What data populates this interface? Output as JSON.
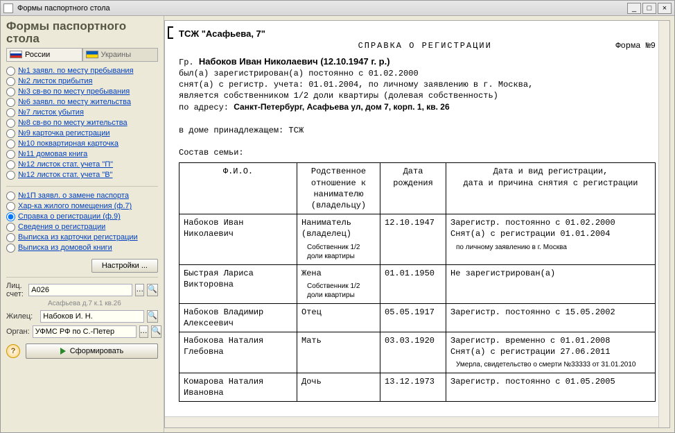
{
  "window": {
    "title": "Формы паспортного стола"
  },
  "sidebar": {
    "heading": "Формы паспортного стола",
    "tabs": {
      "russia": "России",
      "ukraine": "Украины"
    },
    "forms": [
      "№1  заявл. по месту пребывания",
      "№2 листок прибытия",
      "№3 св-во по месту пребывания",
      "№6  заявл. по месту жительства",
      "№7 листок убытия",
      "№8 св-во по месту жительства",
      "№9 карточка регистрации",
      "№10 поквартирная карточка",
      "№11 домовая книга",
      "№12 листок стат. учета \"П\"",
      "№12 листок стат. учета \"В\""
    ],
    "extra": [
      "№1П  заявл. о замене паспорта",
      "Хар-ка жилого помещения (ф.7)",
      "Справка о регистрации (ф.9)",
      "Сведения о регистрации",
      "Выписка из карточки регистрации",
      "Выписка из домовой книги"
    ],
    "extra_selected_index": 2,
    "settings_btn": "Настройки ...",
    "fields": {
      "account_label": "Лиц. счет:",
      "account_value": "A026",
      "account_hint": "Асафьева д.7 к.1 кв.26",
      "tenant_label": "Жилец:",
      "tenant_value": "Набоков И. Н.",
      "organ_label": "Орган:",
      "organ_value": "УФМС РФ по С.-Петер"
    },
    "run_btn": "Сформировать"
  },
  "doc": {
    "org": "ТСЖ \"Асафьева, 7\"",
    "title": "СПРАВКА О РЕГИСТРАЦИИ",
    "form_no": "Форма №9",
    "person_prefix": "Гр.",
    "person_name": "Набоков Иван Николаевич (12.10.1947 г. р.)",
    "line1": "был(а) зарегистрирован(а) постоянно с 01.02.2000",
    "line2": "снят(а) с регистр. учета: 01.01.2004, по личному заявлению в г. Москва,",
    "line3": "является собственником 1/2 доли квартиры (долевая собственность)",
    "addr_prefix": "по адресу:",
    "addr": "Санкт-Петербург, Асафьева ул, дом 7, корп. 1, кв. 26",
    "house_line": "в доме принадлежащем: ТСЖ",
    "family_caption": "Состав семьи:",
    "headers": {
      "fio": "Ф.И.О.",
      "relation": "Родственное отношение к нанимателю (владельцу)",
      "dob": "Дата рождения",
      "reg": "Дата и вид регистрации,\nдата и причина снятия с регистрации"
    },
    "rows": [
      {
        "fio": "Набоков Иван Николаевич",
        "relation": "Наниматель (владелец)",
        "relation_sub": "Собственник 1/2 доли квартиры",
        "dob": "12.10.1947",
        "reg": "Зарегистр. постоянно с 01.02.2000\nСнят(а) с регистрации  01.01.2004",
        "reg_sub": "по личному заявлению в г. Москва"
      },
      {
        "fio": "Быстрая Лариса Викторовна",
        "relation": "Жена",
        "relation_sub": "Собственник 1/2 доли квартиры",
        "dob": "01.01.1950",
        "reg": "Не зарегистрирован(а)"
      },
      {
        "fio": "Набоков Владимир Алексеевич",
        "relation": "Отец",
        "dob": "05.05.1917",
        "reg": "Зарегистр. постоянно с 15.05.2002"
      },
      {
        "fio": "Набокова Наталия Глебовна",
        "relation": "Мать",
        "dob": "03.03.1920",
        "reg": "Зарегистр. временно с 01.01.2008\nСнят(а) с регистрации  27.06.2011",
        "reg_sub": "Умерла, свидетельство о смерти №33333 от 31.01.2010"
      },
      {
        "fio": "Комарова Наталия Ивановна",
        "relation": "Дочь",
        "dob": "13.12.1973",
        "reg": "Зарегистр. постоянно с 01.05.2005"
      }
    ]
  }
}
